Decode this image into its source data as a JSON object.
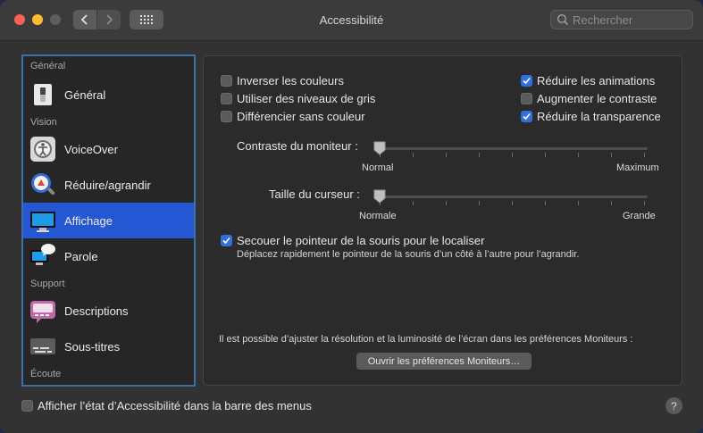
{
  "window": {
    "title": "Accessibilité"
  },
  "search": {
    "placeholder": "Rechercher"
  },
  "sidebar": {
    "sections": [
      "Général",
      "Vision",
      "Support",
      "Écoute"
    ],
    "items": [
      {
        "label": "Général",
        "icon": "switch-icon"
      },
      {
        "label": "VoiceOver",
        "icon": "voiceover-icon"
      },
      {
        "label": "Réduire/agrandir",
        "icon": "zoom-icon"
      },
      {
        "label": "Affichage",
        "icon": "display-icon",
        "selected": true
      },
      {
        "label": "Parole",
        "icon": "speech-icon"
      },
      {
        "label": "Descriptions",
        "icon": "descriptions-icon"
      },
      {
        "label": "Sous-titres",
        "icon": "captions-icon"
      }
    ]
  },
  "display": {
    "checkboxes_left": [
      {
        "label": "Inverser les couleurs",
        "checked": false
      },
      {
        "label": "Utiliser des niveaux de gris",
        "checked": false
      },
      {
        "label": "Différencier sans couleur",
        "checked": false
      }
    ],
    "checkboxes_right": [
      {
        "label": "Réduire les animations",
        "checked": true
      },
      {
        "label": "Augmenter le contraste",
        "checked": false
      },
      {
        "label": "Réduire la transparence",
        "checked": true
      }
    ],
    "contrast": {
      "label": "Contraste du moniteur :",
      "min": "Normal",
      "max": "Maximum",
      "value": 0
    },
    "cursor": {
      "label": "Taille du curseur :",
      "min": "Normale",
      "max": "Grande",
      "value": 0
    },
    "shake": {
      "label": "Secouer le pointeur de la souris pour le localiser",
      "checked": true,
      "description": "Déplacez rapidement le pointeur de la souris d’un côté à l’autre pour l’agrandir."
    },
    "monitors_text": "Il est possible d’ajuster la résolution et la luminosité de l’écran dans les préférences Moniteurs :",
    "monitors_button": "Ouvrir les préférences Moniteurs…"
  },
  "footer": {
    "menu_bar_checkbox": "Afficher l’état d’Accessibilité dans la barre des menus",
    "menu_bar_checked": false,
    "help": "?"
  },
  "colors": {
    "accent": "#2f6fe0",
    "selection": "#2457d3"
  }
}
